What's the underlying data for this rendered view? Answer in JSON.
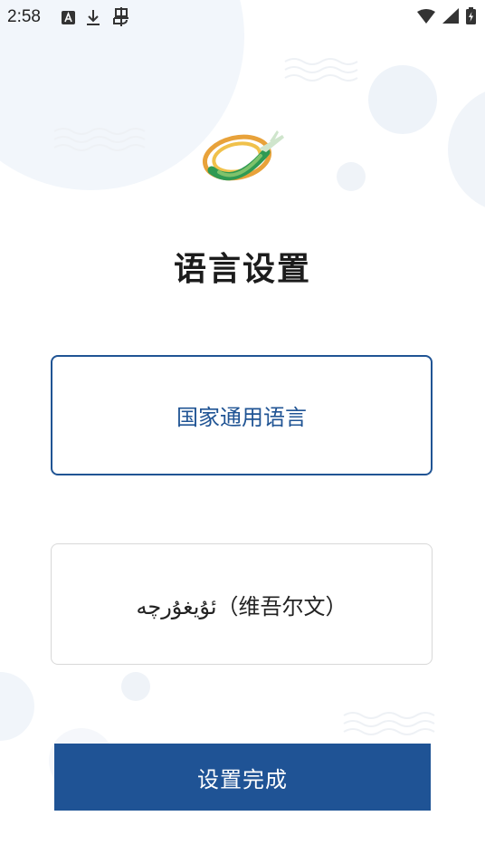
{
  "status_bar": {
    "time": "2:58",
    "left_icons": [
      "keyboard-icon",
      "download-icon",
      "bug-icon"
    ],
    "right_icons": [
      "wifi-icon",
      "signal-icon",
      "battery-charging-icon"
    ]
  },
  "page": {
    "title": "语言设置"
  },
  "language_options": [
    {
      "label": "国家通用语言",
      "selected": true
    },
    {
      "label": "ئۇيغۇرچە（维吾尔文）",
      "selected": false
    }
  ],
  "confirm_button": {
    "label": "设置完成"
  },
  "colors": {
    "accent": "#1f5395",
    "selected_border": "#205494",
    "unselected_border": "#d8d8d8",
    "title_text": "#1c1c1c",
    "background_decor": "#f1f5fb"
  }
}
